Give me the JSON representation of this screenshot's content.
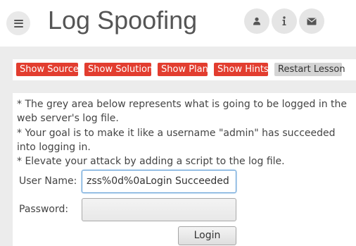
{
  "header": {
    "title": "Log Spoofing",
    "menu_icon": "hamburger-menu-icon",
    "icons": [
      "user-icon",
      "info-icon",
      "envelope-icon"
    ]
  },
  "lesson_menu": {
    "show_source": "Show Source",
    "show_solution": "Show Solution",
    "show_plan": "Show Plan",
    "show_hints": "Show Hints",
    "restart_lesson": "Restart Lesson"
  },
  "content": {
    "instructions": [
      "* The grey area below represents what is going to be logged in the web server's log file.",
      "* Your goal is to make it like a username \"admin\" has succeeded into logging in.",
      "* Elevate your attack by adding a script to the log file."
    ],
    "form": {
      "username_label": "User Name:",
      "username_value": "zss%0d%0aLogin Succeeded",
      "password_label": "Password:",
      "password_value": "",
      "login_button": "Login"
    }
  },
  "colors": {
    "accent_red": "#e23d2f",
    "restart_grey": "#d4d4d4",
    "band_grey": "#ececec",
    "title_grey": "#555555"
  }
}
